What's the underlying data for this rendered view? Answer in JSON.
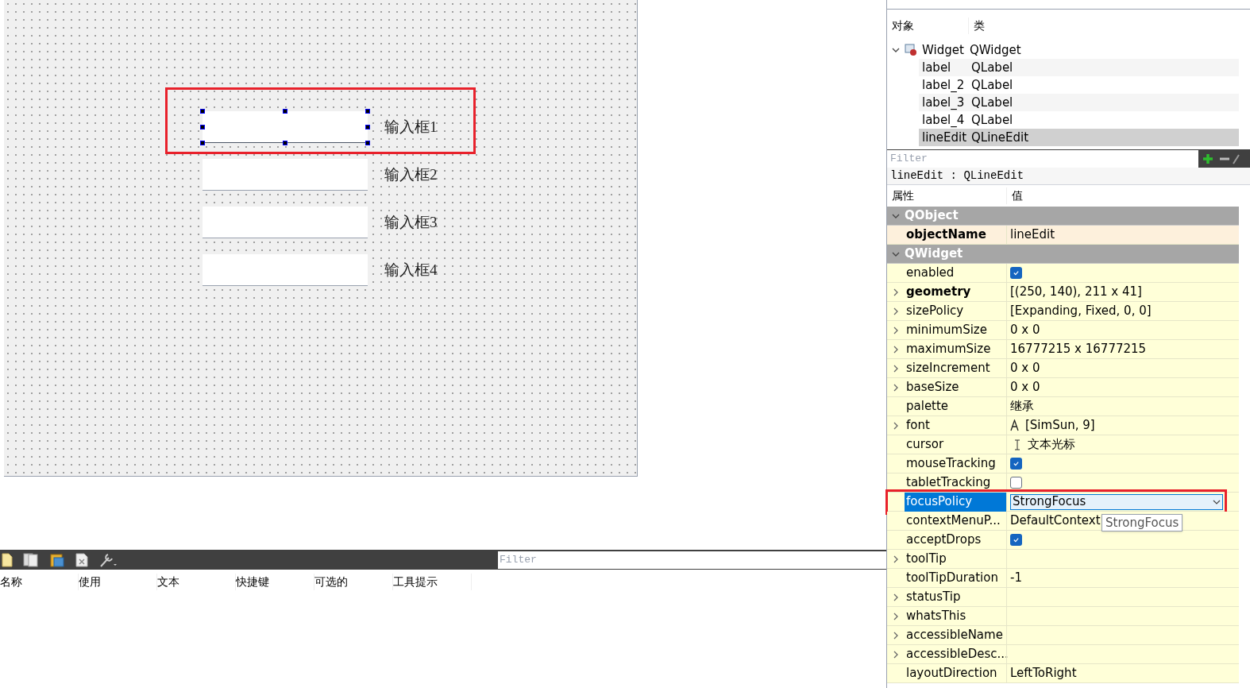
{
  "form": {
    "fields": [
      {
        "label": "输入框1",
        "selected": true
      },
      {
        "label": "输入框2",
        "selected": false
      },
      {
        "label": "输入框3",
        "selected": false
      },
      {
        "label": "输入框4",
        "selected": false
      }
    ]
  },
  "action_editor": {
    "filter": {
      "placeholder": "Filter"
    },
    "columns": [
      "名称",
      "使用",
      "文本",
      "快捷键",
      "可选的",
      "工具提示"
    ]
  },
  "object_inspector": {
    "columns": [
      "对象",
      "类"
    ],
    "tree": [
      {
        "name": "Widget",
        "class": "QWidget",
        "expanded": true,
        "selected": false,
        "children": [
          {
            "name": "label",
            "class": "QLabel",
            "selected": false
          },
          {
            "name": "label_2",
            "class": "QLabel",
            "selected": false
          },
          {
            "name": "label_3",
            "class": "QLabel",
            "selected": false
          },
          {
            "name": "label_4",
            "class": "QLabel",
            "selected": false
          },
          {
            "name": "lineEdit",
            "class": "QLineEdit",
            "selected": true
          }
        ]
      }
    ]
  },
  "property_editor": {
    "filter": {
      "placeholder": "Filter"
    },
    "object_title": "lineEdit : QLineEdit",
    "columns": [
      "属性",
      "值"
    ],
    "groups": [
      {
        "name": "QObject",
        "expanded": true,
        "rows": [
          {
            "kind": "text",
            "name": "objectName",
            "bold": true,
            "expandable": false,
            "value": "lineEdit",
            "selected": false
          }
        ]
      },
      {
        "name": "QWidget",
        "expanded": true,
        "rows": [
          {
            "kind": "check",
            "name": "enabled",
            "bold": false,
            "expandable": false,
            "checked": true,
            "selected": false
          },
          {
            "kind": "text",
            "name": "geometry",
            "bold": true,
            "expandable": true,
            "value": "[(250, 140), 211 x 41]",
            "selected": false
          },
          {
            "kind": "text",
            "name": "sizePolicy",
            "bold": false,
            "expandable": true,
            "value": "[Expanding, Fixed, 0, 0]",
            "selected": false
          },
          {
            "kind": "text",
            "name": "minimumSize",
            "bold": false,
            "expandable": true,
            "value": "0 x 0",
            "selected": false
          },
          {
            "kind": "text",
            "name": "maximumSize",
            "bold": false,
            "expandable": true,
            "value": "16777215 x 16777215",
            "selected": false
          },
          {
            "kind": "text",
            "name": "sizeIncrement",
            "bold": false,
            "expandable": true,
            "value": "0 x 0",
            "selected": false
          },
          {
            "kind": "text",
            "name": "baseSize",
            "bold": false,
            "expandable": true,
            "value": "0 x 0",
            "selected": false
          },
          {
            "kind": "text",
            "name": "palette",
            "bold": false,
            "expandable": false,
            "value": "继承",
            "selected": false
          },
          {
            "kind": "font",
            "name": "font",
            "bold": false,
            "expandable": true,
            "value": "[SimSun, 9]",
            "selected": false
          },
          {
            "kind": "cursor",
            "name": "cursor",
            "bold": false,
            "expandable": false,
            "value": "文本光标",
            "selected": false
          },
          {
            "kind": "check",
            "name": "mouseTracking",
            "bold": false,
            "expandable": false,
            "checked": true,
            "selected": false
          },
          {
            "kind": "check",
            "name": "tabletTracking",
            "bold": false,
            "expandable": false,
            "checked": false,
            "selected": false
          },
          {
            "kind": "combo",
            "name": "focusPolicy",
            "bold": false,
            "expandable": false,
            "value": "StrongFocus",
            "selected": true,
            "tooltip": "StrongFocus"
          },
          {
            "kind": "text",
            "name": "contextMenuP...",
            "bold": false,
            "expandable": false,
            "value": "DefaultContext",
            "selected": false
          },
          {
            "kind": "check",
            "name": "acceptDrops",
            "bold": false,
            "expandable": false,
            "checked": true,
            "selected": false
          },
          {
            "kind": "text",
            "name": "toolTip",
            "bold": false,
            "expandable": true,
            "selected": false
          },
          {
            "kind": "text",
            "name": "toolTipDuration",
            "bold": false,
            "expandable": false,
            "value": "-1",
            "selected": false
          },
          {
            "kind": "text",
            "name": "statusTip",
            "bold": false,
            "expandable": true,
            "selected": false
          },
          {
            "kind": "text",
            "name": "whatsThis",
            "bold": false,
            "expandable": true,
            "selected": false
          },
          {
            "kind": "text",
            "name": "accessibleName",
            "bold": false,
            "expandable": true,
            "selected": false
          },
          {
            "kind": "text",
            "name": "accessibleDesc...",
            "bold": false,
            "expandable": true,
            "selected": false
          },
          {
            "kind": "text",
            "name": "layoutDirection",
            "bold": false,
            "expandable": false,
            "value": "LeftToRight",
            "selected": false
          }
        ]
      }
    ]
  }
}
